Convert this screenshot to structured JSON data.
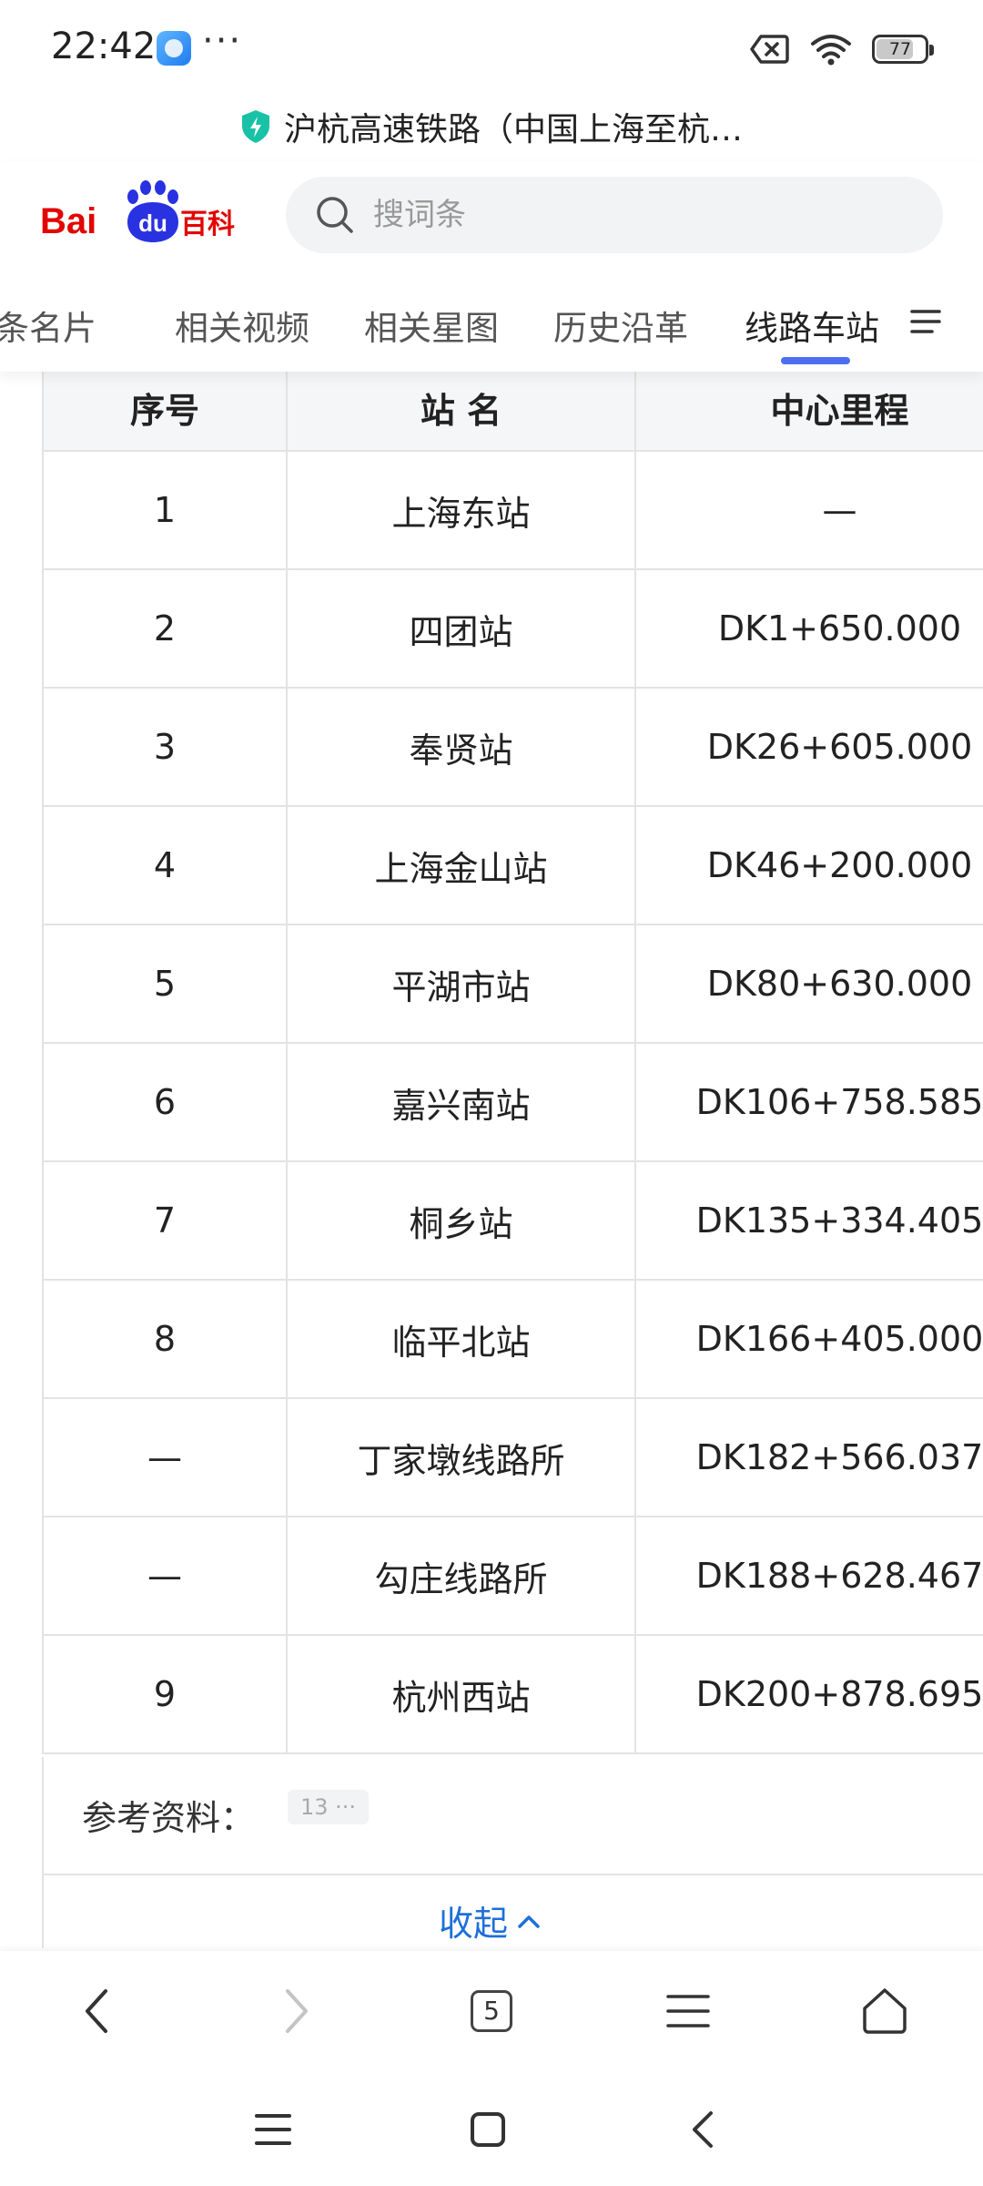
{
  "status_bar": {
    "time": "22:42",
    "dots": "···",
    "battery": "77",
    "battery_level": 0.77
  },
  "page_title": "沪杭高速铁路（中国上海至杭…",
  "header": {
    "search_placeholder": "搜词条",
    "tabs": [
      {
        "label": "词条名片"
      },
      {
        "label": "相关视频"
      },
      {
        "label": "相关星图"
      },
      {
        "label": "历史沿革"
      },
      {
        "label": "线路车站",
        "active": true
      }
    ]
  },
  "table": {
    "headers": [
      "序号",
      "站 名",
      "中心里程"
    ],
    "rows": [
      {
        "seq": "1",
        "name": "上海东站",
        "link": true,
        "km": "—"
      },
      {
        "seq": "2",
        "name": "四团站",
        "link": true,
        "km": "DK1+650.000"
      },
      {
        "seq": "3",
        "name": "奉贤站",
        "link": true,
        "km": "DK26+605.000"
      },
      {
        "seq": "4",
        "name": "上海金山站",
        "link": true,
        "km": "DK46+200.000"
      },
      {
        "seq": "5",
        "name": "平湖市站",
        "link": true,
        "km": "DK80+630.000"
      },
      {
        "seq": "6",
        "name": "嘉兴南站",
        "link": true,
        "km": "DK106+758.585"
      },
      {
        "seq": "7",
        "name": "桐乡站",
        "link": true,
        "km": "DK135+334.405"
      },
      {
        "seq": "8",
        "name": "临平北站",
        "link": true,
        "km": "DK166+405.000"
      },
      {
        "seq": "—",
        "name": "丁家墩线路所",
        "link": false,
        "km": "DK182+566.037"
      },
      {
        "seq": "—",
        "name": "勾庄线路所",
        "link": false,
        "km": "DK188+628.467"
      },
      {
        "seq": "9",
        "name": "杭州西站",
        "link": true,
        "km": "DK200+878.695"
      }
    ]
  },
  "references": {
    "label": "参考资料：",
    "badge": "13 ···"
  },
  "collapse_label": "收起",
  "browser_toolbar": {
    "tab_count": "5"
  },
  "colors": {
    "link": "#1e6fd9",
    "accent": "#4e6ef2",
    "baidu_red": "#e10602",
    "baidu_blue": "#2932e1"
  }
}
